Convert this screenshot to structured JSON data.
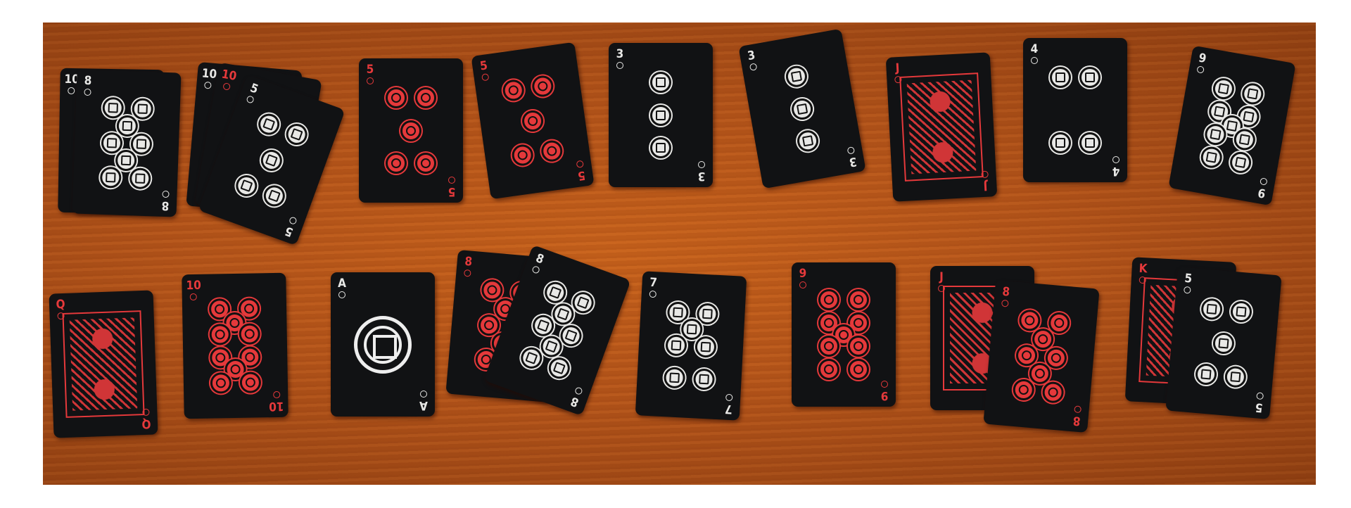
{
  "scene": "playing cards on wooden table",
  "colors": {
    "card_back": "#111214",
    "red_ink": "#e5393b",
    "white_ink": "#e8e8e6",
    "table_wood": "#b4541a"
  },
  "cards": [
    {
      "rank": "10",
      "color": "white",
      "pip": "skull-crossbones"
    },
    {
      "rank": "8",
      "color": "white",
      "pip": "skull-crossbones"
    },
    {
      "rank": "10",
      "color": "white",
      "pip": "skull-crossbones"
    },
    {
      "rank": "10",
      "color": "red",
      "pip": "dial"
    },
    {
      "rank": "5",
      "color": "white",
      "pip": "skull-crossbones"
    },
    {
      "rank": "5",
      "color": "red",
      "pip": "dial"
    },
    {
      "rank": "5",
      "color": "red",
      "pip": "keyhole"
    },
    {
      "rank": "3",
      "color": "white",
      "pip": "safe"
    },
    {
      "rank": "3",
      "color": "white",
      "pip": "skull-crossbones"
    },
    {
      "rank": "J",
      "color": "red",
      "pip": "face"
    },
    {
      "rank": "4",
      "color": "white",
      "pip": "safe"
    },
    {
      "rank": "9",
      "color": "white",
      "pip": "safe"
    },
    {
      "rank": "Q",
      "color": "red",
      "pip": "face"
    },
    {
      "rank": "10",
      "color": "red",
      "pip": "dial"
    },
    {
      "rank": "A",
      "color": "white",
      "pip": "safe"
    },
    {
      "rank": "8",
      "color": "red",
      "pip": "keyhole"
    },
    {
      "rank": "8",
      "color": "white",
      "pip": "safe"
    },
    {
      "rank": "7",
      "color": "white",
      "pip": "safe"
    },
    {
      "rank": "9",
      "color": "red",
      "pip": "dial"
    },
    {
      "rank": "J",
      "color": "red",
      "pip": "face"
    },
    {
      "rank": "8",
      "color": "red",
      "pip": "dial"
    },
    {
      "rank": "K",
      "color": "red",
      "pip": "face"
    },
    {
      "rank": "5",
      "color": "white",
      "pip": "safe"
    }
  ]
}
